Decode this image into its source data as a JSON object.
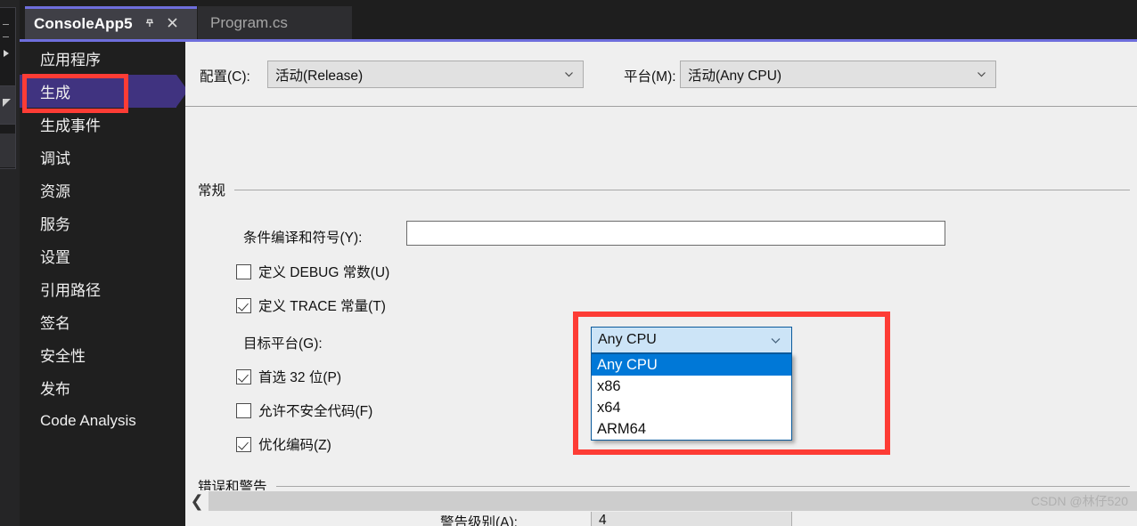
{
  "window": {
    "tabs": [
      {
        "title": "ConsoleApp5",
        "active": true,
        "pin_icon": "pin-icon",
        "close_icon": "close-icon"
      },
      {
        "title": "Program.cs",
        "active": false
      }
    ],
    "accent_color": "#6e6edc",
    "selected_nav_color": "#403380",
    "annotation_color": "#fd3c35"
  },
  "sidebar": {
    "items": [
      {
        "label": "应用程序",
        "selected": false
      },
      {
        "label": "生成",
        "selected": true
      },
      {
        "label": "生成事件",
        "selected": false
      },
      {
        "label": "调试",
        "selected": false
      },
      {
        "label": "资源",
        "selected": false
      },
      {
        "label": "服务",
        "selected": false
      },
      {
        "label": "设置",
        "selected": false
      },
      {
        "label": "引用路径",
        "selected": false
      },
      {
        "label": "签名",
        "selected": false
      },
      {
        "label": "安全性",
        "selected": false
      },
      {
        "label": "发布",
        "selected": false
      },
      {
        "label": "Code Analysis",
        "selected": false
      }
    ]
  },
  "content": {
    "config_row": {
      "configuration_label": "配置(C):",
      "configuration_value": "活动(Release)",
      "platform_label": "平台(M):",
      "platform_value": "活动(Any CPU)"
    },
    "general_group": {
      "title": "常规",
      "symbols_label": "条件编译和符号(Y):",
      "symbols_value": "",
      "checkboxes": [
        {
          "label": "定义 DEBUG 常数(U)",
          "checked": false
        },
        {
          "label": "定义 TRACE 常量(T)",
          "checked": true
        }
      ],
      "target_platform_label": "目标平台(G):",
      "lower_checkboxes": [
        {
          "label": "首选 32 位(P)",
          "checked": true
        },
        {
          "label": "允许不安全代码(F)",
          "checked": false
        },
        {
          "label": "优化编码(Z)",
          "checked": true
        }
      ]
    },
    "platform_dropdown": {
      "selected_value": "Any CPU",
      "chevron_icon": "chevron-down-icon",
      "options": [
        {
          "label": "Any CPU",
          "highlighted": true
        },
        {
          "label": "x86",
          "highlighted": false
        },
        {
          "label": "x64",
          "highlighted": false
        },
        {
          "label": "ARM64",
          "highlighted": false
        }
      ]
    },
    "errors_group": {
      "title": "错误和警告",
      "warning_level_label": "警告级别(A):",
      "warning_level_value": "4"
    },
    "scrollbar": {
      "left_arrow_icon": "chevron-left-icon"
    }
  },
  "watermark": "CSDN @林仔520"
}
